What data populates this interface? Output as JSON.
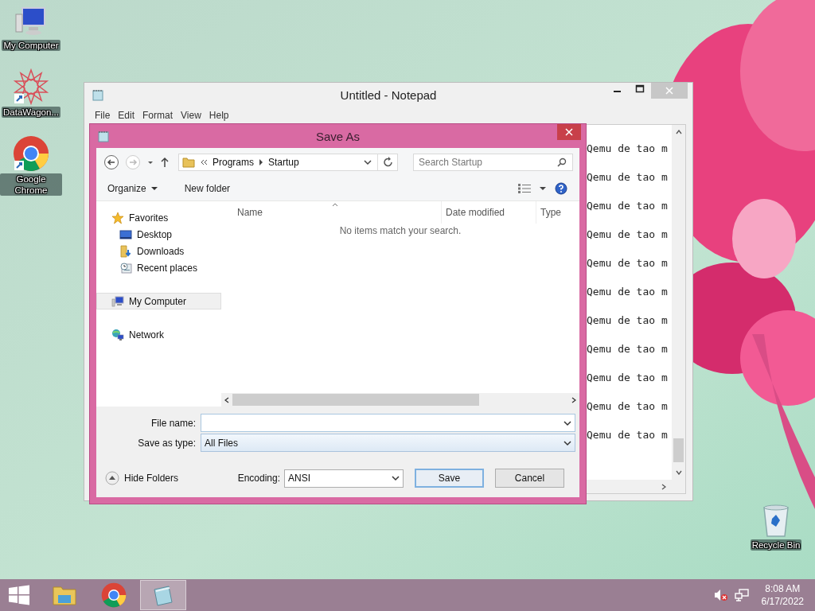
{
  "desktop_icons": [
    {
      "label": "My Computer",
      "kind": "computer"
    },
    {
      "label": "DataWagon...",
      "kind": "star"
    },
    {
      "label": "Google Chrome",
      "kind": "chrome"
    },
    {
      "label": "Recycle Bin",
      "kind": "bin"
    }
  ],
  "notepad": {
    "title": "Untitled - Notepad",
    "menu": [
      "File",
      "Edit",
      "Format",
      "View",
      "Help"
    ],
    "lines": [
      "Qemu de tao m",
      "Qemu de tao m",
      "Qemu de tao m",
      "Qemu de tao m",
      "Qemu de tao m",
      "Qemu de tao m",
      "Qemu de tao m",
      "Qemu de tao m",
      "Qemu de tao m",
      "Qemu de tao m",
      "Qemu de tao m"
    ]
  },
  "save_as": {
    "title": "Save As",
    "path": [
      "Programs",
      "Startup"
    ],
    "search": {
      "placeholder": "Search Startup"
    },
    "toolbar": {
      "organize": "Organize",
      "new_folder": "New folder"
    },
    "nav": [
      {
        "label": "Favorites",
        "kind": "star",
        "selected": false,
        "children": [
          {
            "label": "Desktop",
            "kind": "desktop",
            "selected": false
          },
          {
            "label": "Downloads",
            "kind": "downloads",
            "selected": false
          },
          {
            "label": "Recent places",
            "kind": "recent",
            "selected": false
          }
        ]
      },
      {
        "label": "My Computer",
        "kind": "computer",
        "selected": true
      },
      {
        "label": "Network",
        "kind": "network",
        "selected": false
      }
    ],
    "columns": [
      "Name",
      "Date modified",
      "Type"
    ],
    "empty_message": "No items match your search.",
    "file_name": {
      "label": "File name:"
    },
    "save_as_type": {
      "label": "Save as type:",
      "value": "All Files"
    },
    "hide_folders": "Hide Folders",
    "encoding": {
      "label": "Encoding:",
      "value": "ANSI"
    },
    "buttons": [
      "Save",
      "Cancel"
    ]
  },
  "taskbar": {
    "items": [
      {
        "kind": "explorer",
        "selected": false
      },
      {
        "kind": "chrome",
        "selected": false
      },
      {
        "kind": "notepad",
        "selected": true
      }
    ],
    "time": "8:08 AM",
    "date": "6/17/2022"
  }
}
